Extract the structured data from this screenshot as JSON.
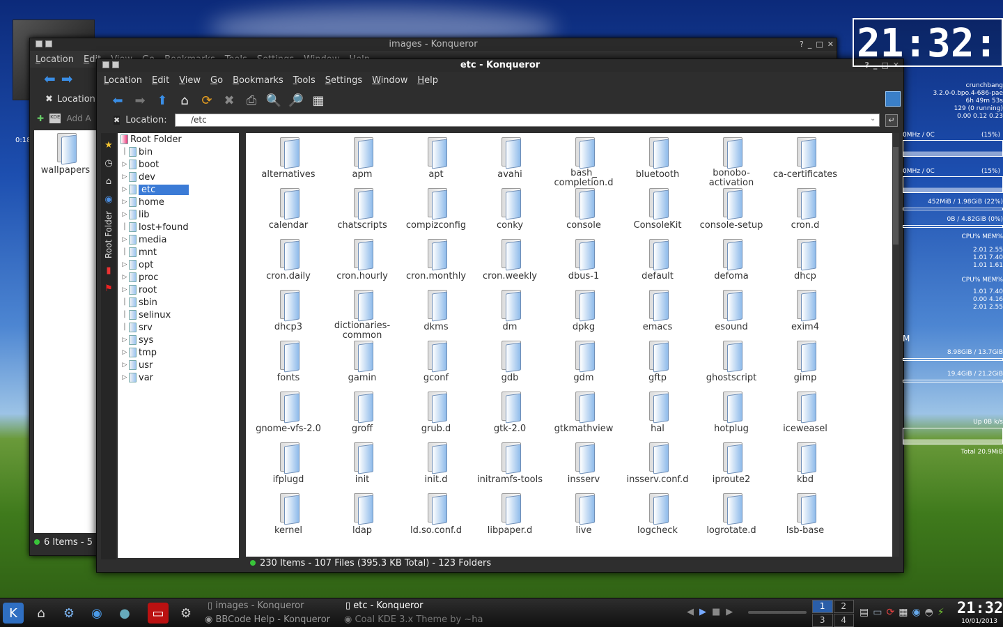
{
  "desktop": {
    "left_label_fragment": "0:18",
    "back_folder_label": "wallpapers"
  },
  "back_window": {
    "title": "images - Konqueror",
    "menu": [
      "Location",
      "Edit",
      "View",
      "Go",
      "Bookmarks",
      "Tools",
      "Settings",
      "Window",
      "Help"
    ],
    "location_label": "Location",
    "add_label": "Add A",
    "status": "6 Items - 5"
  },
  "front_window": {
    "title": "etc - Konqueror",
    "title_buttons": [
      "?",
      "_",
      "□",
      "✕"
    ],
    "menu": [
      "Location",
      "Edit",
      "View",
      "Go",
      "Bookmarks",
      "Tools",
      "Settings",
      "Window",
      "Help"
    ],
    "location_label": "Location:",
    "location_value": "/etc",
    "sidebar_tab_label": "Root Folder",
    "tree": {
      "root": "Root Folder",
      "items": [
        {
          "name": "bin",
          "expandable": false
        },
        {
          "name": "boot",
          "expandable": true
        },
        {
          "name": "dev",
          "expandable": true
        },
        {
          "name": "etc",
          "expandable": true,
          "selected": true
        },
        {
          "name": "home",
          "expandable": true
        },
        {
          "name": "lib",
          "expandable": true
        },
        {
          "name": "lost+found",
          "expandable": false,
          "locked": true
        },
        {
          "name": "media",
          "expandable": true
        },
        {
          "name": "mnt",
          "expandable": false
        },
        {
          "name": "opt",
          "expandable": true
        },
        {
          "name": "proc",
          "expandable": true
        },
        {
          "name": "root",
          "expandable": true
        },
        {
          "name": "sbin",
          "expandable": false
        },
        {
          "name": "selinux",
          "expandable": false
        },
        {
          "name": "srv",
          "expandable": false
        },
        {
          "name": "sys",
          "expandable": true
        },
        {
          "name": "tmp",
          "expandable": true
        },
        {
          "name": "usr",
          "expandable": true
        },
        {
          "name": "var",
          "expandable": true
        }
      ]
    },
    "files": [
      "alternatives",
      "apm",
      "apt",
      "avahi",
      "bash_\ncompletion.d",
      "bluetooth",
      "bonobo-\nactivation",
      "ca-certificates",
      "calendar",
      "chatscripts",
      "compizconfig",
      "conky",
      "console",
      "ConsoleKit",
      "console-setup",
      "cron.d",
      "cron.daily",
      "cron.hourly",
      "cron.monthly",
      "cron.weekly",
      "dbus-1",
      "default",
      "defoma",
      "dhcp",
      "dhcp3",
      "dictionaries-\ncommon",
      "dkms",
      "dm",
      "dpkg",
      "emacs",
      "esound",
      "exim4",
      "fonts",
      "gamin",
      "gconf",
      "gdb",
      "gdm",
      "gftp",
      "ghostscript",
      "gimp",
      "gnome-vfs-2.0",
      "groff",
      "grub.d",
      "gtk-2.0",
      "gtkmathview",
      "hal",
      "hotplug",
      "iceweasel",
      "ifplugd",
      "init",
      "init.d",
      "initramfs-tools",
      "insserv",
      "insserv.conf.d",
      "iproute2",
      "kbd",
      "kernel",
      "ldap",
      "ld.so.conf.d",
      "libpaper.d",
      "live",
      "logcheck",
      "logrotate.d",
      "lsb-base"
    ],
    "status": "230 Items - 107 Files (395.3 KB Total) - 123 Folders"
  },
  "conky": {
    "clock": "21:32:",
    "hostname": "crunchbang",
    "kernel": "3.2.0-0.bpo.4-686-pae",
    "uptime": "6h 49m 53s",
    "processes": "129 (0 running)",
    "loadavg": "0.00 0.12 0.23",
    "cpu1": "0MHz / 0C",
    "cpu1_pct": "(15%)",
    "cpu2": "0MHz / 0C",
    "cpu2_pct": "(15%)",
    "mem": "452MiB / 1.98GiB (22%)",
    "swap": "0B  / 4.82GiB (0%)",
    "top_cpu_header": "CPU% MEM%",
    "top_cpu_rows": [
      "2.01  2.55",
      "1.01  7.40",
      "1.01  1.61"
    ],
    "top_mem_header": "CPU% MEM%",
    "top_mem_rows": [
      "1.01  7.40",
      "0.00  4.16",
      "2.01  2.55"
    ],
    "disk_label": "M",
    "disk1": "8.98GiB / 13.7GiB",
    "disk2": "19.4GiB / 21.2GiB",
    "net_up": "Up 0B   k/s",
    "net_total": "Total 20.9MiB"
  },
  "taskbar": {
    "tasks": [
      "images - Konqueror",
      "BBCode Help - Konqueror",
      "etc - Konqueror",
      "Coal KDE 3.x Theme by ~ha"
    ],
    "pager": [
      "1",
      "2",
      "3",
      "4"
    ],
    "time": "21:32",
    "date": "10/01/2013"
  }
}
